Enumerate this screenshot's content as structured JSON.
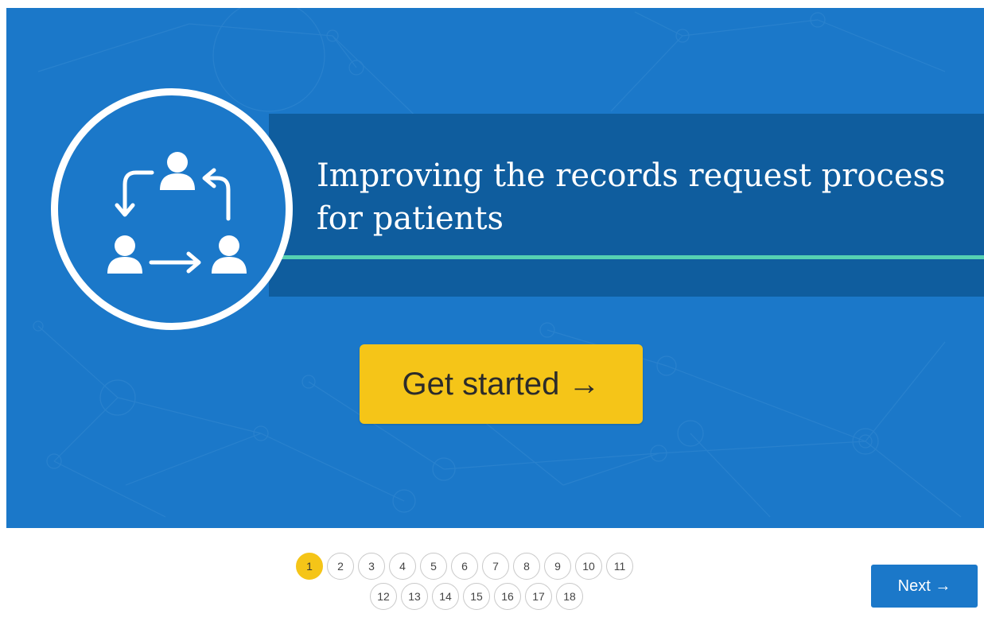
{
  "hero": {
    "title": "Improving the records request process for patients",
    "cta_label": "Get started →",
    "icon": "people-exchange-icon"
  },
  "pagination": {
    "current": "1",
    "row1": [
      "1",
      "2",
      "3",
      "4",
      "5",
      "6",
      "7",
      "8",
      "9",
      "10",
      "11"
    ],
    "row2": [
      "12",
      "13",
      "14",
      "15",
      "16",
      "17",
      "18"
    ]
  },
  "nav": {
    "next_label": "Next →"
  },
  "colors": {
    "hero_background": "#1b78c9",
    "title_band": "#0f5d9e",
    "accent_line": "#55d1b2",
    "cta": "#f5c518",
    "active_page": "#f5c518"
  }
}
